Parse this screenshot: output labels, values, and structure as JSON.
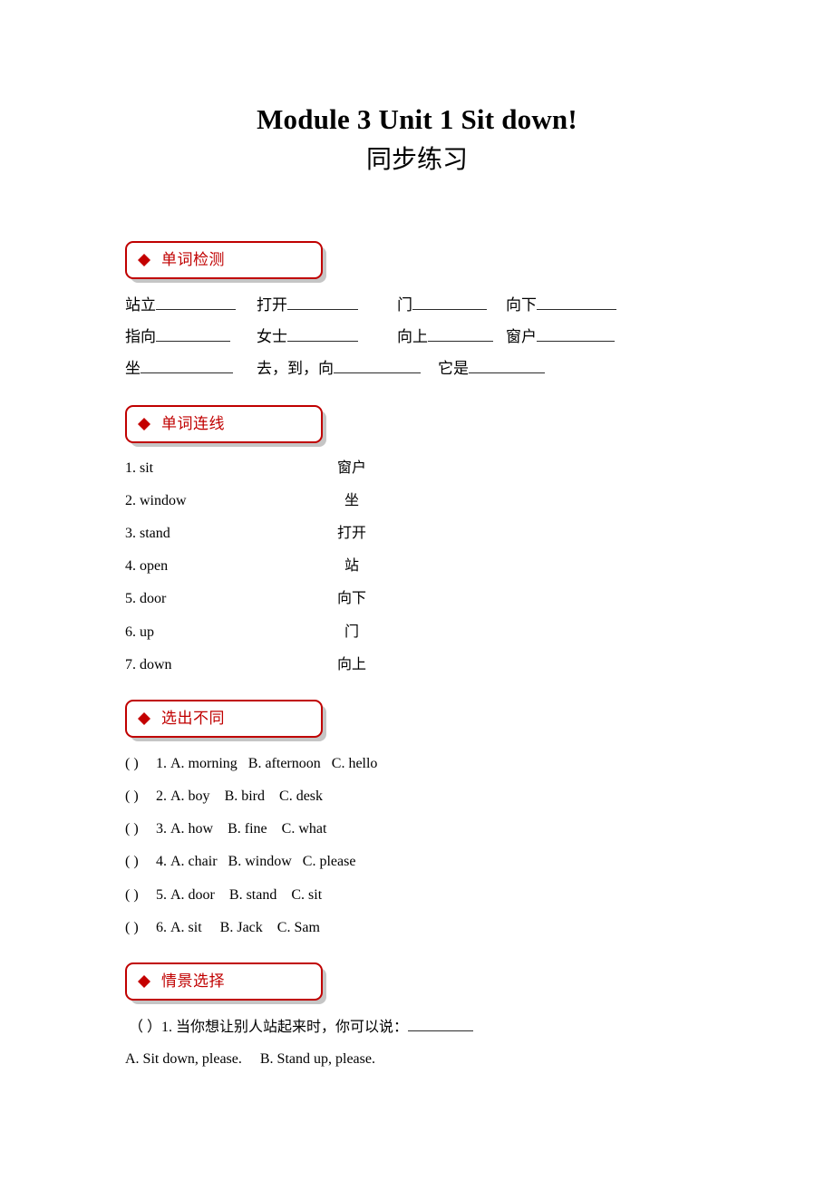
{
  "title": {
    "main": "Module 3 Unit 1 Sit down!",
    "sub": "同步练习"
  },
  "sections": [
    {
      "id": "vocab-check",
      "label": "单词检测",
      "bullet": "diamond-icon"
    },
    {
      "id": "word-match",
      "label": "单词连线",
      "bullet": "diamond-icon"
    },
    {
      "id": "odd-one-out",
      "label": "选出不同",
      "bullet": "diamond-icon"
    },
    {
      "id": "situational",
      "label": "情景选择",
      "bullet": "diamond-icon"
    }
  ],
  "vocab_check": {
    "rows": [
      [
        {
          "prompt": "站立",
          "blank_width": 88
        },
        {
          "prompt": "打开",
          "blank_width": 78
        },
        {
          "prompt": "门",
          "blank_width": 82
        },
        {
          "prompt": "向下",
          "blank_width": 88
        }
      ],
      [
        {
          "prompt": "指向",
          "blank_width": 82
        },
        {
          "prompt": "女士",
          "blank_width": 78
        },
        {
          "prompt": "向上",
          "blank_width": 72
        },
        {
          "prompt": "窗户",
          "blank_width": 86
        }
      ],
      [
        {
          "prompt": "坐",
          "blank_width": 102
        },
        {
          "prompt": "去，到，向",
          "blank_width": 96
        },
        {
          "prompt": "它是",
          "blank_width": 84
        }
      ]
    ]
  },
  "word_match": {
    "pairs": [
      {
        "num": "1.",
        "en": "sit",
        "zh": "窗户"
      },
      {
        "num": "2.",
        "en": "window",
        "zh": "坐"
      },
      {
        "num": "3.",
        "en": "stand",
        "zh": "打开"
      },
      {
        "num": "4.",
        "en": "open",
        "zh": "站"
      },
      {
        "num": "5.",
        "en": "door",
        "zh": "向下"
      },
      {
        "num": "6.",
        "en": "up",
        "zh": "门"
      },
      {
        "num": "7.",
        "en": "down",
        "zh": "向上"
      }
    ]
  },
  "odd_one_out": {
    "paren": "(      )",
    "items": [
      {
        "num": "1.",
        "a": "A. morning",
        "b": "B. afternoon",
        "c": "C. hello"
      },
      {
        "num": "2.",
        "a": "A. boy",
        "b": "B. bird",
        "c": "C. desk"
      },
      {
        "num": "3.",
        "a": "A. how",
        "b": "B. fine",
        "c": "C. what"
      },
      {
        "num": "4.",
        "a": "A. chair",
        "b": "B. window",
        "c": "C. please"
      },
      {
        "num": "5.",
        "a": "A. door",
        "b": "B. stand",
        "c": "C. sit"
      },
      {
        "num": "6.",
        "a": "A. sit",
        "b": "B. Jack",
        "c": "C. Sam"
      }
    ]
  },
  "situational": {
    "question_paren": "（    ）",
    "question_num": "1.",
    "question_text": "当你想让别人站起来时，你可以说：",
    "option_a": "A. Sit down, please.",
    "option_b": "B. Stand up, please."
  },
  "colors": {
    "section_border": "#C00000",
    "section_text": "#C00000",
    "diamond": "#C40000",
    "body_text": "#000000",
    "page_background": "#FFFFFF"
  }
}
